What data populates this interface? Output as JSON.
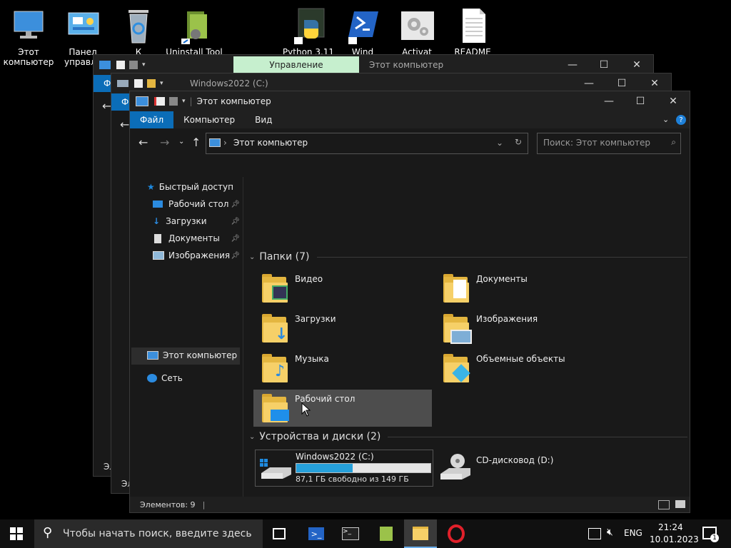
{
  "desktop_icons": [
    {
      "label": "Этот\nкомпьютер"
    },
    {
      "label": "Панел\nуправле"
    },
    {
      "label": "К"
    },
    {
      "label": "Uninstall Tool"
    },
    {
      "label": "Python 3.11"
    },
    {
      "label": "Wind"
    },
    {
      "label": "Activat"
    },
    {
      "label": "README"
    }
  ],
  "back_window1": {
    "ribbon_title": "Управление",
    "title": "Этот компьютер",
    "tab": "Фа",
    "status": "Эл"
  },
  "back_window2": {
    "title": "Windows2022 (C:)",
    "tab": "Фа",
    "status": "Эл"
  },
  "window": {
    "title": "Этот компьютер",
    "tabs": [
      "Файл",
      "Компьютер",
      "Вид"
    ],
    "address": "Этот компьютер",
    "search_placeholder": "Поиск: Этот компьютер",
    "nav": {
      "quick_access": "Быстрый доступ",
      "desktop": "Рабочий стол",
      "downloads": "Загрузки",
      "documents": "Документы",
      "pictures": "Изображения",
      "this_pc": "Этот компьютер",
      "network": "Сеть"
    },
    "folders_header": "Папки (7)",
    "folders": [
      "Видео",
      "Документы",
      "Загрузки",
      "Изображения",
      "Музыка",
      "Объемные объекты",
      "Рабочий стол"
    ],
    "devices_header": "Устройства и диски (2)",
    "drive_c": {
      "name": "Windows2022 (C:)",
      "free": "87,1 ГБ свободно из 149 ГБ",
      "used_fraction": 0.42
    },
    "drive_d": {
      "name": "CD-дисковод (D:)"
    },
    "status": "Элементов: 9"
  },
  "taskbar": {
    "search_placeholder": "Чтобы начать поиск, введите здесь",
    "lang": "ENG",
    "time": "21:24",
    "date": "10.01.2023",
    "notif_count": "1"
  },
  "colors": {
    "accent": "#0b6db8",
    "folder": "#f6d068",
    "selected": "#4d4d4d",
    "drive_bar": "#26a0da"
  }
}
